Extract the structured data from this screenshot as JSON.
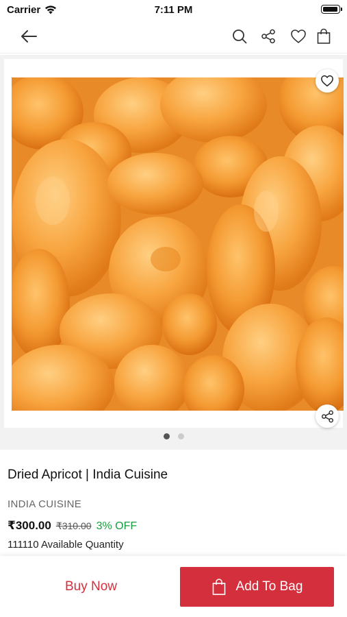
{
  "status_bar": {
    "carrier": "Carrier",
    "time": "7:11 PM"
  },
  "nav": {
    "icons": [
      "back-arrow-icon",
      "search-icon",
      "share-icon",
      "heart-icon",
      "shopping-bag-icon"
    ]
  },
  "gallery": {
    "image_alt": "Dried apricots",
    "page_count": 2,
    "active_page": 1
  },
  "product": {
    "title": "Dried Apricot | India Cuisine",
    "brand": "INDIA CUISINE",
    "price": "₹300.00",
    "mrp": "₹310.00",
    "discount": "3% OFF",
    "available_quantity": "111110 Available Quantity"
  },
  "actions": {
    "buy_now": "Buy Now",
    "add_to_bag": "Add To Bag"
  },
  "colors": {
    "accent": "#d32f3c",
    "discount": "#1a9c3e"
  }
}
